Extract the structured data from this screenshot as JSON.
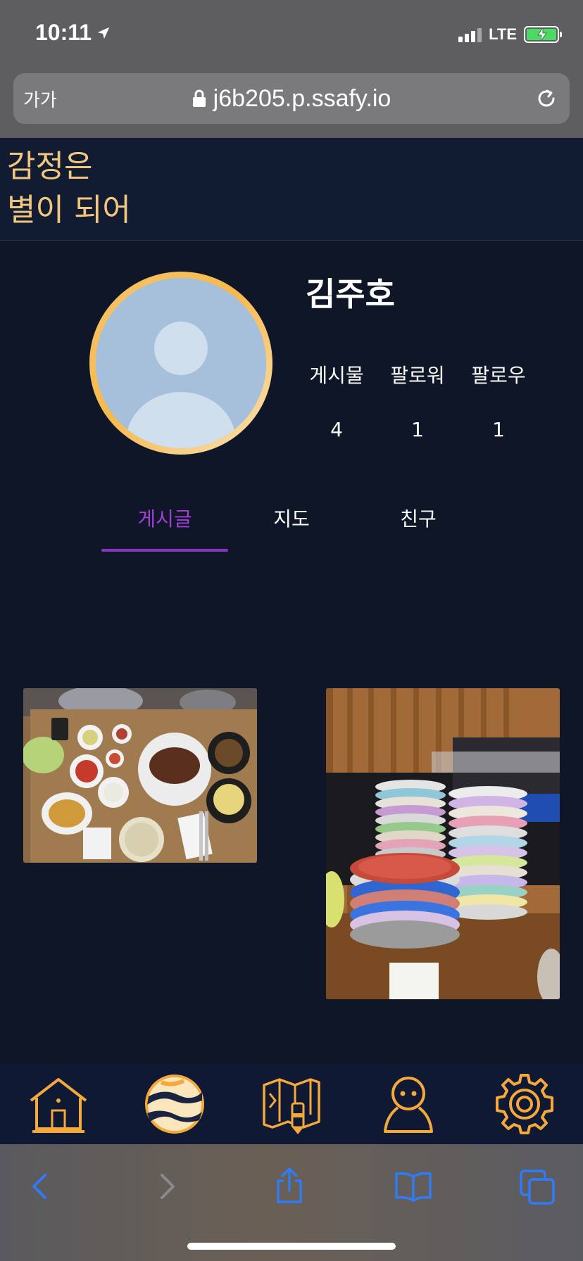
{
  "status_bar": {
    "time": "10:11",
    "network": "LTE",
    "battery_charging": true,
    "icons": [
      "location-arrow-icon",
      "signal-icon",
      "battery-icon"
    ]
  },
  "browser": {
    "text_size_label": "가가",
    "url": "j6b205.p.ssafy.io",
    "icons": [
      "lock-icon",
      "reload-icon"
    ]
  },
  "app": {
    "title_line1": "감정은",
    "title_line2": "별이 되어"
  },
  "profile": {
    "name": "김주호",
    "stats": [
      {
        "label": "게시물",
        "value": "4"
      },
      {
        "label": "팔로워",
        "value": "1"
      },
      {
        "label": "팔로우",
        "value": "1"
      }
    ]
  },
  "tabs": [
    {
      "label": "게시글",
      "active": true
    },
    {
      "label": "지도",
      "active": false
    },
    {
      "label": "친구",
      "active": false
    }
  ],
  "colors": {
    "background": "#0e1627",
    "header": "#111c33",
    "accent_gold": "#f2c77d",
    "tab_active": "#a13fd6",
    "icon_gold": "#f5a93b"
  },
  "bottom_nav": {
    "items": [
      "home-icon",
      "planet-icon",
      "map-pencil-icon",
      "profile-icon",
      "settings-icon"
    ]
  },
  "safari_toolbar": {
    "items": [
      "back-icon",
      "forward-icon",
      "share-icon",
      "bookmarks-icon",
      "tabs-icon"
    ]
  }
}
